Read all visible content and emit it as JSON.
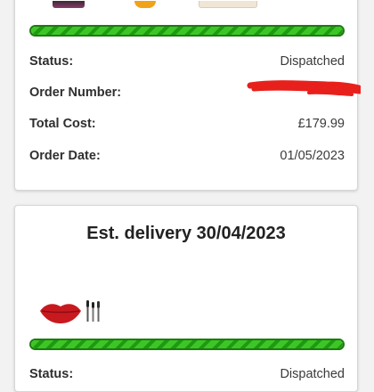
{
  "order1": {
    "status_label": "Status:",
    "status_value": "Dispatched",
    "order_number_label": "Order Number:",
    "total_label": "Total Cost:",
    "total_value": "£179.99",
    "date_label": "Order Date:",
    "date_value": "01/05/2023",
    "progress_fraction": 1.0
  },
  "order2": {
    "title": "Est. delivery 30/04/2023",
    "status_label": "Status:",
    "status_value": "Dispatched",
    "progress_fraction": 1.0,
    "product_icons": [
      "lips-icon",
      "makeup-brushes-icon"
    ]
  },
  "colors": {
    "progress_green": "#2fb31c",
    "progress_dark": "#1f7a12",
    "redaction_red": "#e8201c"
  }
}
